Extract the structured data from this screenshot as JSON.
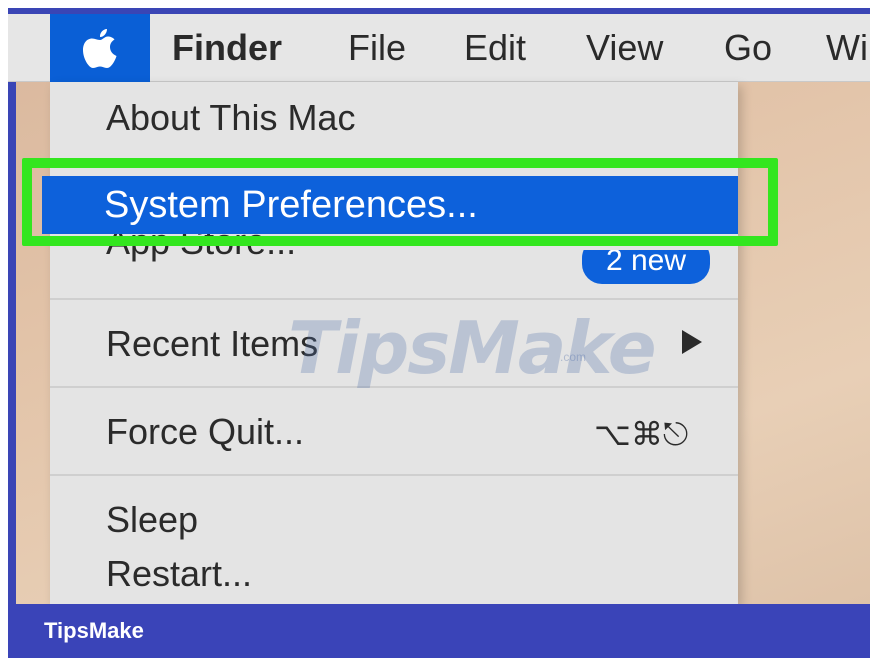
{
  "menubar": {
    "apple_icon": "apple-logo",
    "items": [
      "Finder",
      "File",
      "Edit",
      "View",
      "Go",
      "Wi"
    ]
  },
  "apple_menu": {
    "items": {
      "about": "About This Mac",
      "system_preferences": "System Preferences...",
      "app_store": "App Store...",
      "app_store_badge": "2 new",
      "recent_items": "Recent Items",
      "force_quit": "Force Quit...",
      "force_quit_shortcut": "⌥⌘⎋",
      "sleep": "Sleep",
      "restart": "Restart..."
    },
    "highlighted_item": "System Preferences..."
  },
  "watermark": {
    "text": "TipsMake",
    "suffix": ".com"
  },
  "footer": {
    "brand": "TipsMake"
  },
  "colors": {
    "menu_highlight": "#0d61db",
    "annotation_box": "#33e61f",
    "footer_bar": "#3a44b8"
  }
}
